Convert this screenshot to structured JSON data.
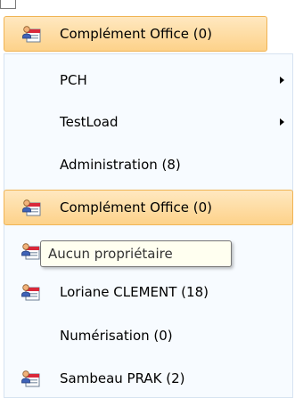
{
  "top_item": {
    "label": "Complément Office (0)",
    "icon": "user-office-icon"
  },
  "menu": {
    "items": [
      {
        "label": "PCH",
        "icon": "",
        "has_submenu": true
      },
      {
        "label": "TestLoad",
        "icon": "",
        "has_submenu": true
      },
      {
        "label": "Administration (8)",
        "icon": "",
        "has_submenu": false
      },
      {
        "label": "Complément Office (0)",
        "icon": "user-office-icon",
        "has_submenu": false,
        "highlighted": true
      },
      {
        "label": "",
        "icon": "user-office-icon",
        "has_submenu": false
      },
      {
        "label": "Loriane CLEMENT (18)",
        "icon": "user-office-icon",
        "has_submenu": false
      },
      {
        "label": "Numérisation (0)",
        "icon": "",
        "has_submenu": false
      },
      {
        "label": "Sambeau PRAK (2)",
        "icon": "user-office-icon",
        "has_submenu": false
      }
    ]
  },
  "tooltip": {
    "text": "Aucun propriétaire"
  },
  "colors": {
    "highlight": "#fdd28a",
    "highlight_border": "#f0b455",
    "menu_bg": "#f7fbff",
    "tooltip_bg": "#fffff0"
  }
}
